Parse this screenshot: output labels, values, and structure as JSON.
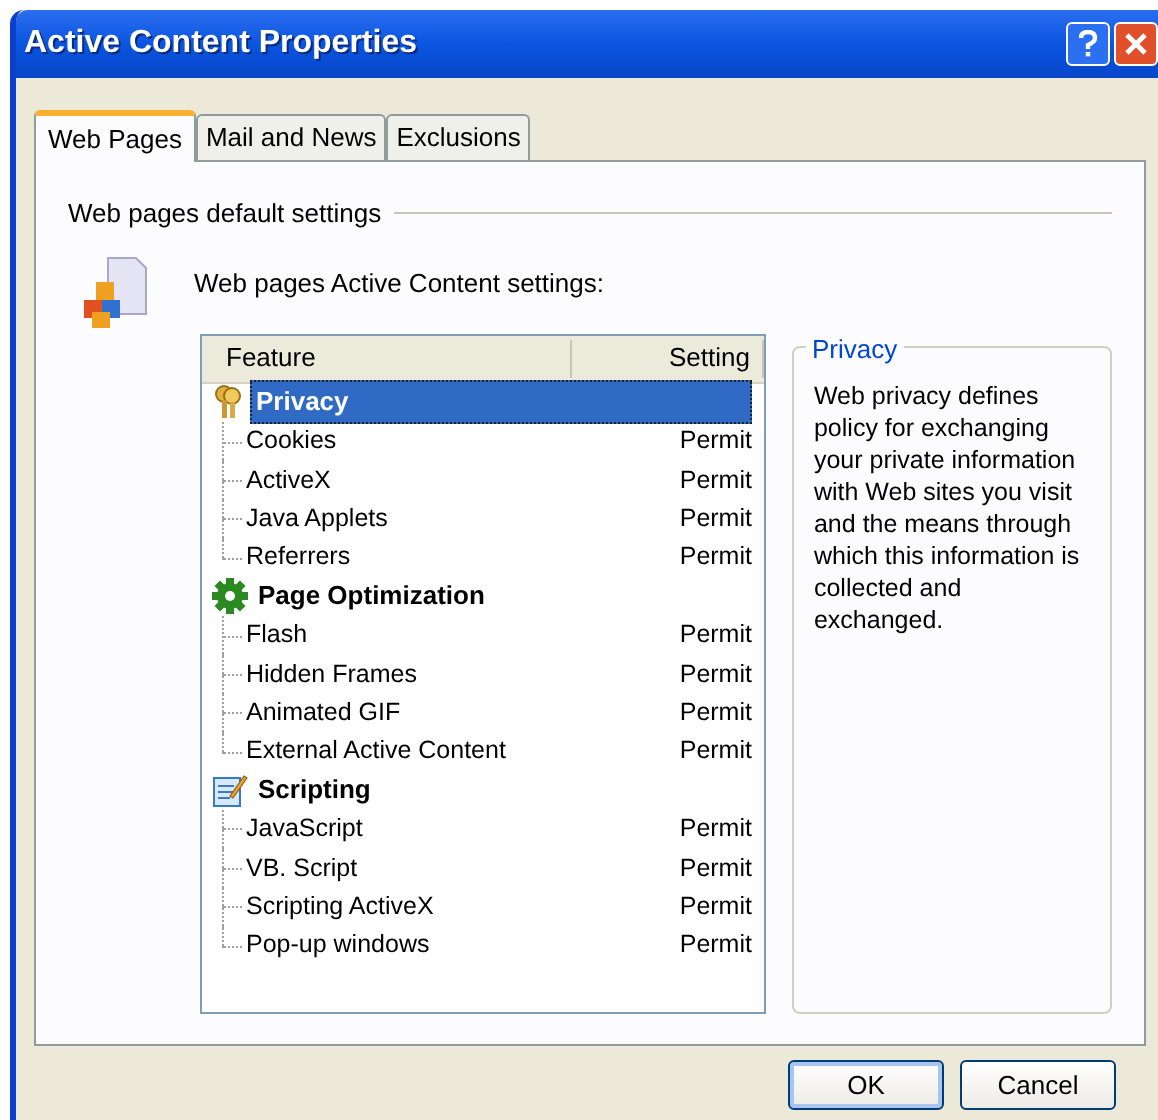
{
  "window": {
    "title": "Active Content Properties"
  },
  "tabs": [
    {
      "label": "Web Pages",
      "selected": true
    },
    {
      "label": "Mail and News",
      "selected": false
    },
    {
      "label": "Exclusions",
      "selected": false
    }
  ],
  "section_title": "Web pages default settings",
  "intro": "Web pages Active Content settings:",
  "table": {
    "columns": [
      "Feature",
      "Setting"
    ],
    "groups": [
      {
        "label": "Privacy",
        "kind": "keys",
        "selected": true,
        "children": [
          {
            "label": "Cookies",
            "setting": "Permit"
          },
          {
            "label": "ActiveX",
            "setting": "Permit"
          },
          {
            "label": "Java Applets",
            "setting": "Permit"
          },
          {
            "label": "Referrers",
            "setting": "Permit"
          }
        ]
      },
      {
        "label": "Page Optimization",
        "kind": "gear",
        "selected": false,
        "children": [
          {
            "label": "Flash",
            "setting": "Permit"
          },
          {
            "label": "Hidden Frames",
            "setting": "Permit"
          },
          {
            "label": "Animated GIF",
            "setting": "Permit"
          },
          {
            "label": "External Active Content",
            "setting": "Permit"
          }
        ]
      },
      {
        "label": "Scripting",
        "kind": "script",
        "selected": false,
        "children": [
          {
            "label": "JavaScript",
            "setting": "Permit"
          },
          {
            "label": "VB. Script",
            "setting": "Permit"
          },
          {
            "label": "Scripting ActiveX",
            "setting": "Permit"
          },
          {
            "label": "Pop-up windows",
            "setting": "Permit"
          }
        ]
      }
    ]
  },
  "description": {
    "title": "Privacy",
    "text": "Web privacy defines policy for exchanging your private information with Web sites you visit and the means through which this information is collected and exchanged."
  },
  "buttons": [
    "OK",
    "Cancel"
  ]
}
